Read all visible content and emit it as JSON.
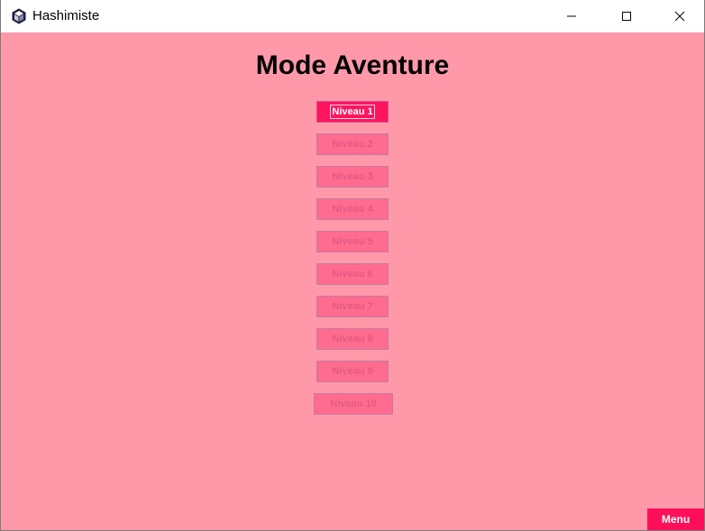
{
  "window": {
    "title": "Hashimiste",
    "app_icon": "hashi-cube-icon"
  },
  "page": {
    "title": "Mode Aventure"
  },
  "levels": [
    {
      "label": "Niveau 1",
      "enabled": true,
      "focused": true
    },
    {
      "label": "Niveau 2",
      "enabled": false
    },
    {
      "label": "Niveau 3",
      "enabled": false
    },
    {
      "label": "Niveau 4",
      "enabled": false
    },
    {
      "label": "Niveau 5",
      "enabled": false
    },
    {
      "label": "Niveau 6",
      "enabled": false
    },
    {
      "label": "Niveau 7",
      "enabled": false
    },
    {
      "label": "Niveau 8",
      "enabled": false
    },
    {
      "label": "Niveau 9",
      "enabled": false
    },
    {
      "label": "Niveau 10",
      "enabled": false
    }
  ],
  "footer": {
    "menu_label": "Menu"
  },
  "colors": {
    "background": "#ff99aa",
    "button_active": "#ff1460",
    "button_disabled": "#ff6c8f",
    "menu_button": "#ff0f5a"
  }
}
